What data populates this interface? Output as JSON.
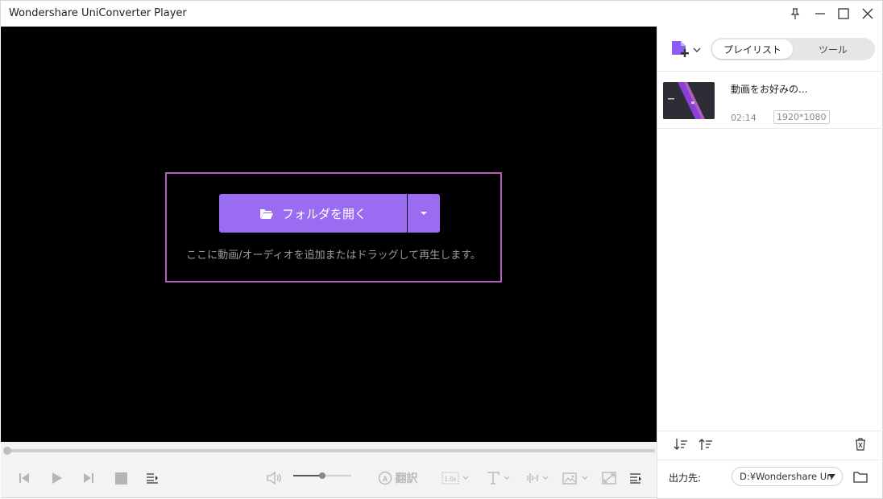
{
  "window": {
    "title": "Wondershare UniConverter Player"
  },
  "player": {
    "open_folder_label": "フォルダを開く",
    "drop_hint": "ここに動画/オーディオを追加またはドラッグして再生します。",
    "progress_fraction": 0.0,
    "volume_fraction": 0.5
  },
  "controls": {
    "translate_label": "翻訳",
    "speed_label": "1.0x",
    "icons": [
      "prev-icon",
      "play-icon",
      "next-icon",
      "stop-icon",
      "playlist-toggle-icon",
      "volume-icon",
      "translate-icon",
      "speed-icon",
      "subtitle-icon",
      "audio-track-icon",
      "screenshot-icon",
      "aspect-icon",
      "menu-icon"
    ]
  },
  "panel": {
    "tabs": [
      {
        "label": "プレイリスト",
        "active": true
      },
      {
        "label": "ツール",
        "active": false
      }
    ],
    "playlist": [
      {
        "title": "動画をお好みの...",
        "duration": "02:14",
        "resolution": "1920*1080"
      }
    ],
    "output_label": "出力先:",
    "output_path": "D:¥Wondershare Un"
  },
  "colors": {
    "accent": "#9a6cf2",
    "drop_border": "#b35dbe",
    "video_bg": "#000000"
  }
}
